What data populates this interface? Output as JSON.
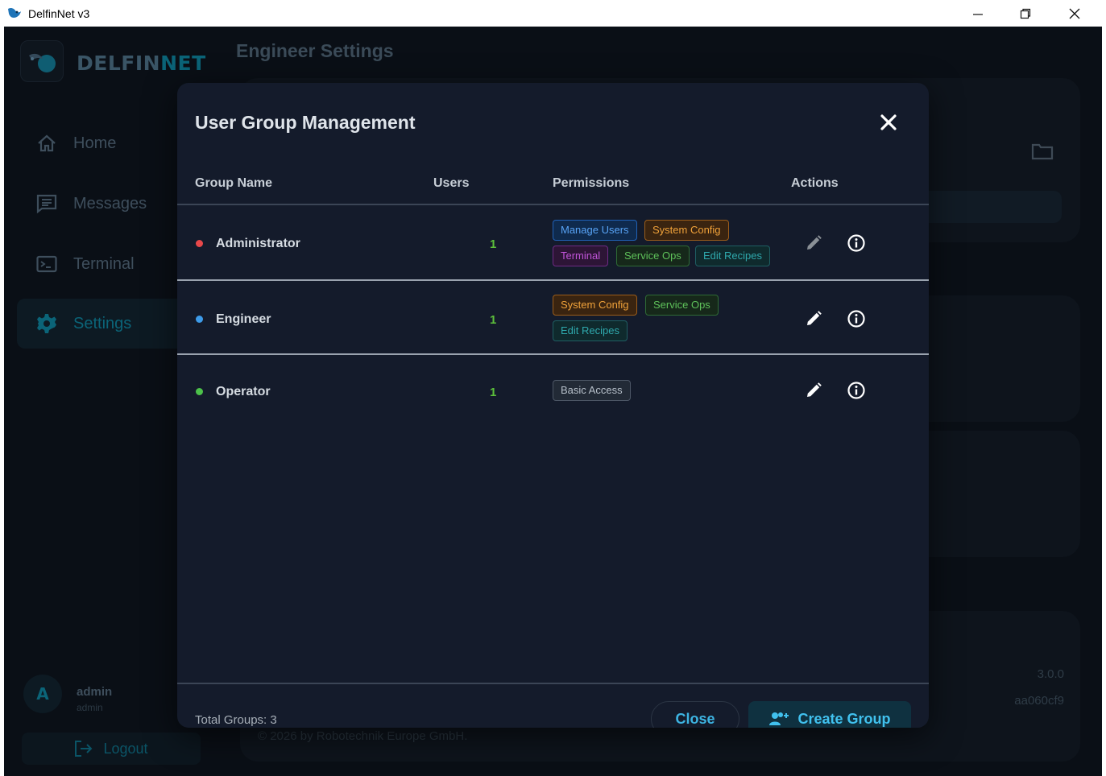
{
  "window": {
    "title": "DelfinNet v3"
  },
  "brand": {
    "name_a": "DELFIN",
    "name_b": "NET"
  },
  "sidebar": {
    "items": [
      {
        "label": "Home",
        "icon": "home-icon"
      },
      {
        "label": "Messages",
        "icon": "message-icon"
      },
      {
        "label": "Terminal",
        "icon": "terminal-icon"
      },
      {
        "label": "Settings",
        "icon": "gear-icon",
        "active": true
      }
    ],
    "user": {
      "avatar_letter": "A",
      "name": "admin",
      "role": "admin"
    },
    "logout_label": "Logout"
  },
  "page": {
    "title": "Engineer Settings",
    "version": "3.0.0",
    "build": "aa060cf9",
    "copyright": "© 2026 by Robotechnik Europe GmbH."
  },
  "modal": {
    "title": "User Group Management",
    "columns": {
      "name": "Group Name",
      "users": "Users",
      "permissions": "Permissions",
      "actions": "Actions"
    },
    "groups": [
      {
        "name": "Administrator",
        "dot_color": "#e8484a",
        "users": "1",
        "permissions": [
          "Manage Users",
          "System Config",
          "Terminal",
          "Service Ops",
          "Edit Recipes"
        ]
      },
      {
        "name": "Engineer",
        "dot_color": "#3d9be9",
        "users": "1",
        "permissions": [
          "System Config",
          "Service Ops",
          "Edit Recipes"
        ]
      },
      {
        "name": "Operator",
        "dot_color": "#4cc14a",
        "users": "1",
        "permissions": [
          "Basic Access"
        ]
      }
    ],
    "total_label": "Total Groups: 3",
    "close_label": "Close",
    "create_label": "Create Group"
  },
  "colors": {
    "accent": "#41c1ee",
    "background": "#0a0f16",
    "modal_bg": "#141b2b"
  }
}
